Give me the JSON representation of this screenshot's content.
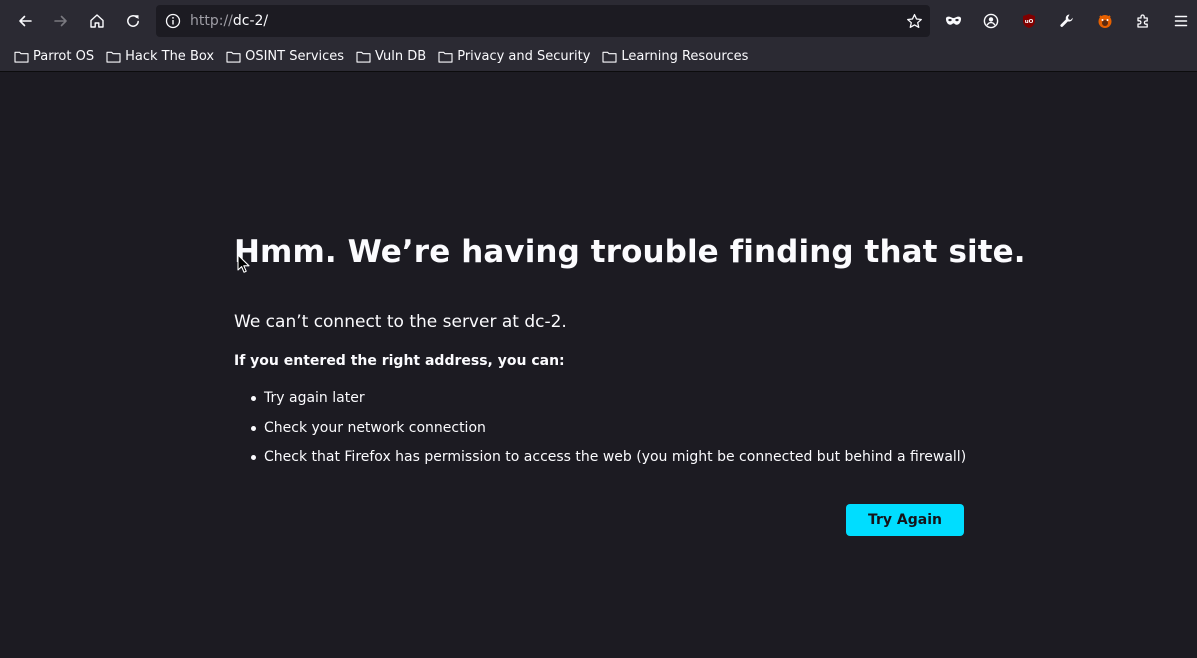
{
  "browser": {
    "url_protocol": "http://",
    "url_host": "dc-2/",
    "bookmarks": [
      {
        "label": "Parrot OS"
      },
      {
        "label": "Hack The Box"
      },
      {
        "label": "OSINT Services"
      },
      {
        "label": "Vuln DB"
      },
      {
        "label": "Privacy and Security"
      },
      {
        "label": "Learning Resources"
      }
    ],
    "icons": {
      "back": "back-arrow-icon",
      "forward": "forward-arrow-icon",
      "home": "home-icon",
      "reload": "reload-icon",
      "info": "info-icon",
      "bookmark_star": "star-icon",
      "private": "mask-icon",
      "account": "account-icon",
      "ublock": "ublock-origin-icon",
      "tools": "wrench-icon",
      "foxy": "foxyproxy-icon",
      "extensions": "puzzle-icon",
      "menu": "hamburger-menu-icon"
    },
    "colors": {
      "toolbar_bg": "#2b2a33",
      "page_bg": "#1c1b22",
      "accent": "#00ddff",
      "ublock": "#800000"
    }
  },
  "error_page": {
    "title": "Hmm. We’re having trouble finding that site.",
    "description": "We can’t connect to the server at dc-2.",
    "advice_heading": "If you entered the right address, you can:",
    "tips": [
      "Try again later",
      "Check your network connection",
      "Check that Firefox has permission to access the web (you might be connected but behind a firewall)"
    ],
    "try_again_label": "Try Again"
  }
}
